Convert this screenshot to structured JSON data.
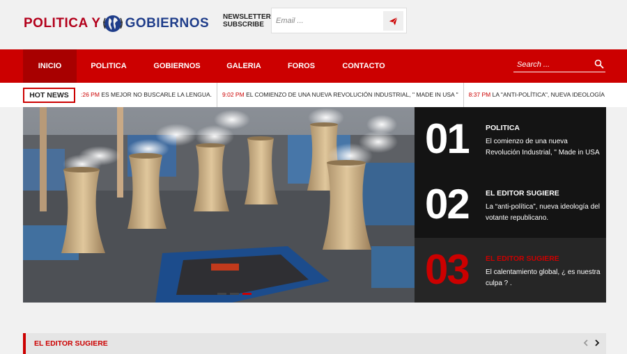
{
  "brand": {
    "part1": "POLITICA Y",
    "part2": "GOBIERNOS"
  },
  "newsletter": {
    "line1": "NEWSLETTER",
    "line2": "SUBSCRIBE",
    "placeholder": "Email ..."
  },
  "nav": {
    "items": [
      "INICIO",
      "POLITICA",
      "GOBIERNOS",
      "GALERIA",
      "FOROS",
      "CONTACTO"
    ],
    "active": "INICIO",
    "search_placeholder": "Search ..."
  },
  "hot_news": {
    "label": "HOT NEWS",
    "items": [
      {
        "time": ":26 PM",
        "text": "ES MEJOR NO BUSCARLE LA LENGUA."
      },
      {
        "time": "9:02 PM",
        "text": "EL COMIENZO DE UNA NUEVA REVOLUCIÓN INDUSTRIAL, \" MADE IN USA \""
      },
      {
        "time": "8:37 PM",
        "text": "LA \"ANTI-POLÍTICA\", NUEVA IDEOLOGÍA DEL VOTANTE RE"
      }
    ]
  },
  "featured": [
    {
      "number": "01",
      "category": "POLITICA",
      "title": "El comienzo de una nueva Revolución Industrial, \" Made in USA"
    },
    {
      "number": "02",
      "category": "EL EDITOR SUGIERE",
      "title": "La “anti-política”, nueva ideología del votante republicano."
    },
    {
      "number": "03",
      "category": "EL EDITOR SUGIERE",
      "title": "El calentamiento global, ¿ es nuestra culpa ? ."
    }
  ],
  "section": {
    "title": "EL EDITOR SUGIERE"
  },
  "colors": {
    "accent": "#cc0000",
    "brand_red": "#b3001b",
    "brand_blue": "#1f3d8a",
    "dark": "#141414"
  }
}
